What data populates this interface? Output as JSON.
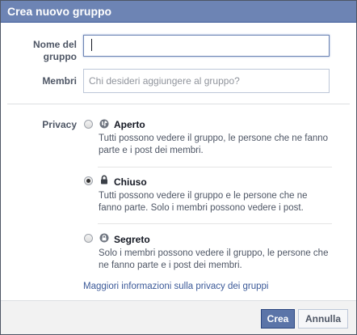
{
  "dialog": {
    "title": "Crea nuovo gruppo"
  },
  "form": {
    "name_label": "Nome del gruppo",
    "name_value": "",
    "members_label": "Membri",
    "members_placeholder": "Chi desideri aggiungere al gruppo?",
    "privacy_label": "Privacy"
  },
  "privacy_options": [
    {
      "title": "Aperto",
      "icon": "globe-icon",
      "selected": false,
      "description": "Tutti possono vedere il gruppo, le persone che ne fanno parte e i post dei membri."
    },
    {
      "title": "Chiuso",
      "icon": "lock-icon",
      "selected": true,
      "description": "Tutti possono vedere il gruppo e le persone che ne fanno parte. Solo i membri possono vedere i post."
    },
    {
      "title": "Segreto",
      "icon": "secret-lock-icon",
      "selected": false,
      "description": "Solo i membri possono vedere il gruppo, le persone che ne fanno parte e i post dei membri."
    }
  ],
  "privacy_link": "Maggiori informazioni sulla privacy dei gruppi",
  "buttons": {
    "create": "Crea",
    "cancel": "Annulla"
  },
  "colors": {
    "header_bg": "#6d84b4",
    "primary_button": "#5b74a8",
    "link": "#3b5998"
  }
}
